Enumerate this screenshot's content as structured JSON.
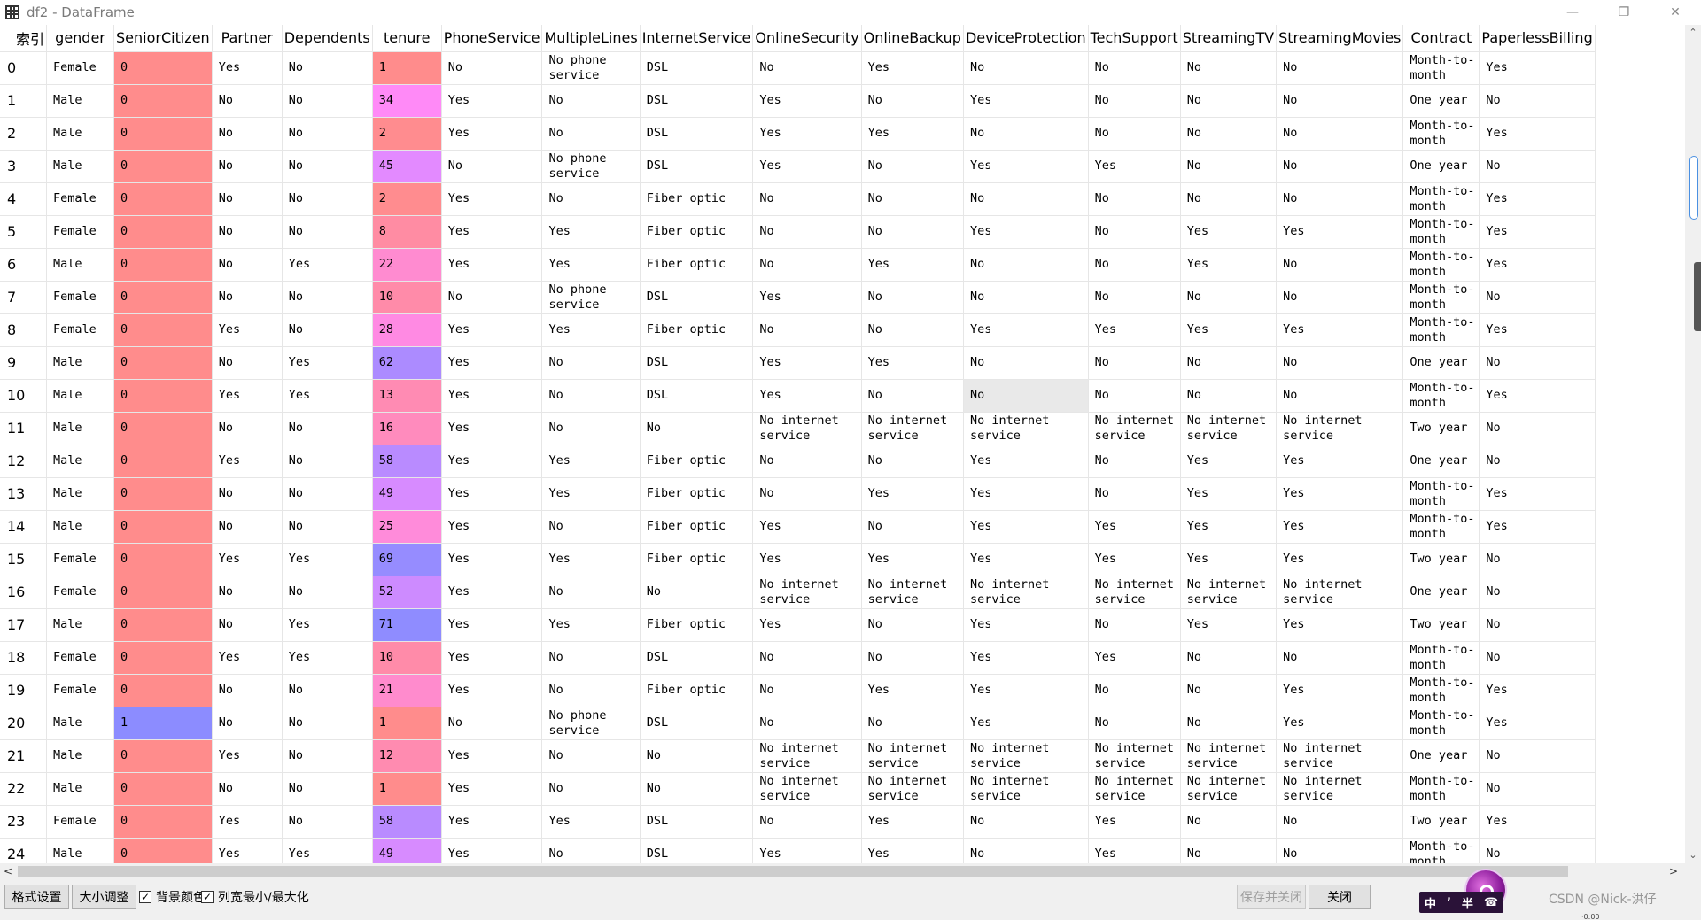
{
  "window": {
    "title": "df2 - DataFrame",
    "buttons": [
      "—",
      "❐",
      "✕"
    ]
  },
  "table": {
    "columns": [
      "索引",
      "gender",
      "SeniorCitizen",
      "Partner",
      "Dependents",
      "tenure",
      "PhoneService",
      "MultipleLines",
      "InternetService",
      "OnlineSecurity",
      "OnlineBackup",
      "DeviceProtection",
      "TechSupport",
      "StreamingTV",
      "StreamingMovies",
      "Contract",
      "PaperlessBilling"
    ],
    "rows": [
      [
        "0",
        "Female",
        "0",
        "Yes",
        "No",
        "1",
        "No",
        "No phone service",
        "DSL",
        "No",
        "Yes",
        "No",
        "No",
        "No",
        "No",
        "Month-to-month",
        "Yes"
      ],
      [
        "1",
        "Male",
        "0",
        "No",
        "No",
        "34",
        "Yes",
        "No",
        "DSL",
        "Yes",
        "No",
        "Yes",
        "No",
        "No",
        "No",
        "One year",
        "No"
      ],
      [
        "2",
        "Male",
        "0",
        "No",
        "No",
        "2",
        "Yes",
        "No",
        "DSL",
        "Yes",
        "Yes",
        "No",
        "No",
        "No",
        "No",
        "Month-to-month",
        "Yes"
      ],
      [
        "3",
        "Male",
        "0",
        "No",
        "No",
        "45",
        "No",
        "No phone service",
        "DSL",
        "Yes",
        "No",
        "Yes",
        "Yes",
        "No",
        "No",
        "One year",
        "No"
      ],
      [
        "4",
        "Female",
        "0",
        "No",
        "No",
        "2",
        "Yes",
        "No",
        "Fiber optic",
        "No",
        "No",
        "No",
        "No",
        "No",
        "No",
        "Month-to-month",
        "Yes"
      ],
      [
        "5",
        "Female",
        "0",
        "No",
        "No",
        "8",
        "Yes",
        "Yes",
        "Fiber optic",
        "No",
        "No",
        "Yes",
        "No",
        "Yes",
        "Yes",
        "Month-to-month",
        "Yes"
      ],
      [
        "6",
        "Male",
        "0",
        "No",
        "Yes",
        "22",
        "Yes",
        "Yes",
        "Fiber optic",
        "No",
        "Yes",
        "No",
        "No",
        "Yes",
        "No",
        "Month-to-month",
        "Yes"
      ],
      [
        "7",
        "Female",
        "0",
        "No",
        "No",
        "10",
        "No",
        "No phone service",
        "DSL",
        "Yes",
        "No",
        "No",
        "No",
        "No",
        "No",
        "Month-to-month",
        "No"
      ],
      [
        "8",
        "Female",
        "0",
        "Yes",
        "No",
        "28",
        "Yes",
        "Yes",
        "Fiber optic",
        "No",
        "No",
        "Yes",
        "Yes",
        "Yes",
        "Yes",
        "Month-to-month",
        "Yes"
      ],
      [
        "9",
        "Male",
        "0",
        "No",
        "Yes",
        "62",
        "Yes",
        "No",
        "DSL",
        "Yes",
        "Yes",
        "No",
        "No",
        "No",
        "No",
        "One year",
        "No"
      ],
      [
        "10",
        "Male",
        "0",
        "Yes",
        "Yes",
        "13",
        "Yes",
        "No",
        "DSL",
        "Yes",
        "No",
        "No",
        "No",
        "No",
        "No",
        "Month-to-month",
        "Yes"
      ],
      [
        "11",
        "Male",
        "0",
        "No",
        "No",
        "16",
        "Yes",
        "No",
        "No",
        "No internet service",
        "No internet service",
        "No internet service",
        "No internet service",
        "No internet service",
        "No internet service",
        "Two year",
        "No"
      ],
      [
        "12",
        "Male",
        "0",
        "Yes",
        "No",
        "58",
        "Yes",
        "Yes",
        "Fiber optic",
        "No",
        "No",
        "Yes",
        "No",
        "Yes",
        "Yes",
        "One year",
        "No"
      ],
      [
        "13",
        "Male",
        "0",
        "No",
        "No",
        "49",
        "Yes",
        "Yes",
        "Fiber optic",
        "No",
        "Yes",
        "Yes",
        "No",
        "Yes",
        "Yes",
        "Month-to-month",
        "Yes"
      ],
      [
        "14",
        "Male",
        "0",
        "No",
        "No",
        "25",
        "Yes",
        "No",
        "Fiber optic",
        "Yes",
        "No",
        "Yes",
        "Yes",
        "Yes",
        "Yes",
        "Month-to-month",
        "Yes"
      ],
      [
        "15",
        "Female",
        "0",
        "Yes",
        "Yes",
        "69",
        "Yes",
        "Yes",
        "Fiber optic",
        "Yes",
        "Yes",
        "Yes",
        "Yes",
        "Yes",
        "Yes",
        "Two year",
        "No"
      ],
      [
        "16",
        "Female",
        "0",
        "No",
        "No",
        "52",
        "Yes",
        "No",
        "No",
        "No internet service",
        "No internet service",
        "No internet service",
        "No internet service",
        "No internet service",
        "No internet service",
        "One year",
        "No"
      ],
      [
        "17",
        "Male",
        "0",
        "No",
        "Yes",
        "71",
        "Yes",
        "Yes",
        "Fiber optic",
        "Yes",
        "No",
        "Yes",
        "No",
        "Yes",
        "Yes",
        "Two year",
        "No"
      ],
      [
        "18",
        "Female",
        "0",
        "Yes",
        "Yes",
        "10",
        "Yes",
        "No",
        "DSL",
        "No",
        "No",
        "Yes",
        "Yes",
        "No",
        "No",
        "Month-to-month",
        "No"
      ],
      [
        "19",
        "Female",
        "0",
        "No",
        "No",
        "21",
        "Yes",
        "No",
        "Fiber optic",
        "No",
        "Yes",
        "Yes",
        "No",
        "No",
        "Yes",
        "Month-to-month",
        "Yes"
      ],
      [
        "20",
        "Male",
        "1",
        "No",
        "No",
        "1",
        "No",
        "No phone service",
        "DSL",
        "No",
        "No",
        "Yes",
        "No",
        "No",
        "Yes",
        "Month-to-month",
        "Yes"
      ],
      [
        "21",
        "Male",
        "0",
        "Yes",
        "No",
        "12",
        "Yes",
        "No",
        "No",
        "No internet service",
        "No internet service",
        "No internet service",
        "No internet service",
        "No internet service",
        "No internet service",
        "One year",
        "No"
      ],
      [
        "22",
        "Male",
        "0",
        "No",
        "No",
        "1",
        "Yes",
        "No",
        "No",
        "No internet service",
        "No internet service",
        "No internet service",
        "No internet service",
        "No internet service",
        "No internet service",
        "Month-to-month",
        "No"
      ],
      [
        "23",
        "Female",
        "0",
        "Yes",
        "No",
        "58",
        "Yes",
        "Yes",
        "DSL",
        "No",
        "Yes",
        "No",
        "Yes",
        "No",
        "No",
        "Two year",
        "Yes"
      ],
      [
        "24",
        "Male",
        "0",
        "Yes",
        "Yes",
        "49",
        "Yes",
        "No",
        "DSL",
        "Yes",
        "Yes",
        "No",
        "Yes",
        "No",
        "No",
        "Month-to-month",
        "No"
      ]
    ],
    "selected_cell": {
      "row": 10,
      "column": "DeviceProtection"
    },
    "heat_colors": {
      "low": "#ff8c8c",
      "mid": "#ff8aff",
      "high": "#8c8cff"
    },
    "heat_columns": [
      "SeniorCitizen",
      "tenure"
    ],
    "heat_ranges": {
      "SeniorCitizen": [
        0,
        1
      ],
      "tenure": [
        1,
        72
      ]
    }
  },
  "scrollbars": {
    "up_arrow": "⌃",
    "down_arrow": "⌄",
    "left_arrow": "<",
    "right_arrow": ">"
  },
  "bottombar": {
    "format_button": "格式设置",
    "resize_button": "大小调整",
    "bg_color_checkbox": {
      "label": "背景颜色",
      "checked": true
    },
    "col_width_checkbox": {
      "label": "列宽最小/最大化",
      "checked": true
    },
    "save_close_button": "保存并关闭",
    "close_button": "关闭"
  },
  "overlay": {
    "badge_text": [
      "中",
      "ʼ",
      "半",
      "☎"
    ],
    "watermark": "CSDN @Nick-洪仔",
    "stray_text": "·0:00"
  }
}
